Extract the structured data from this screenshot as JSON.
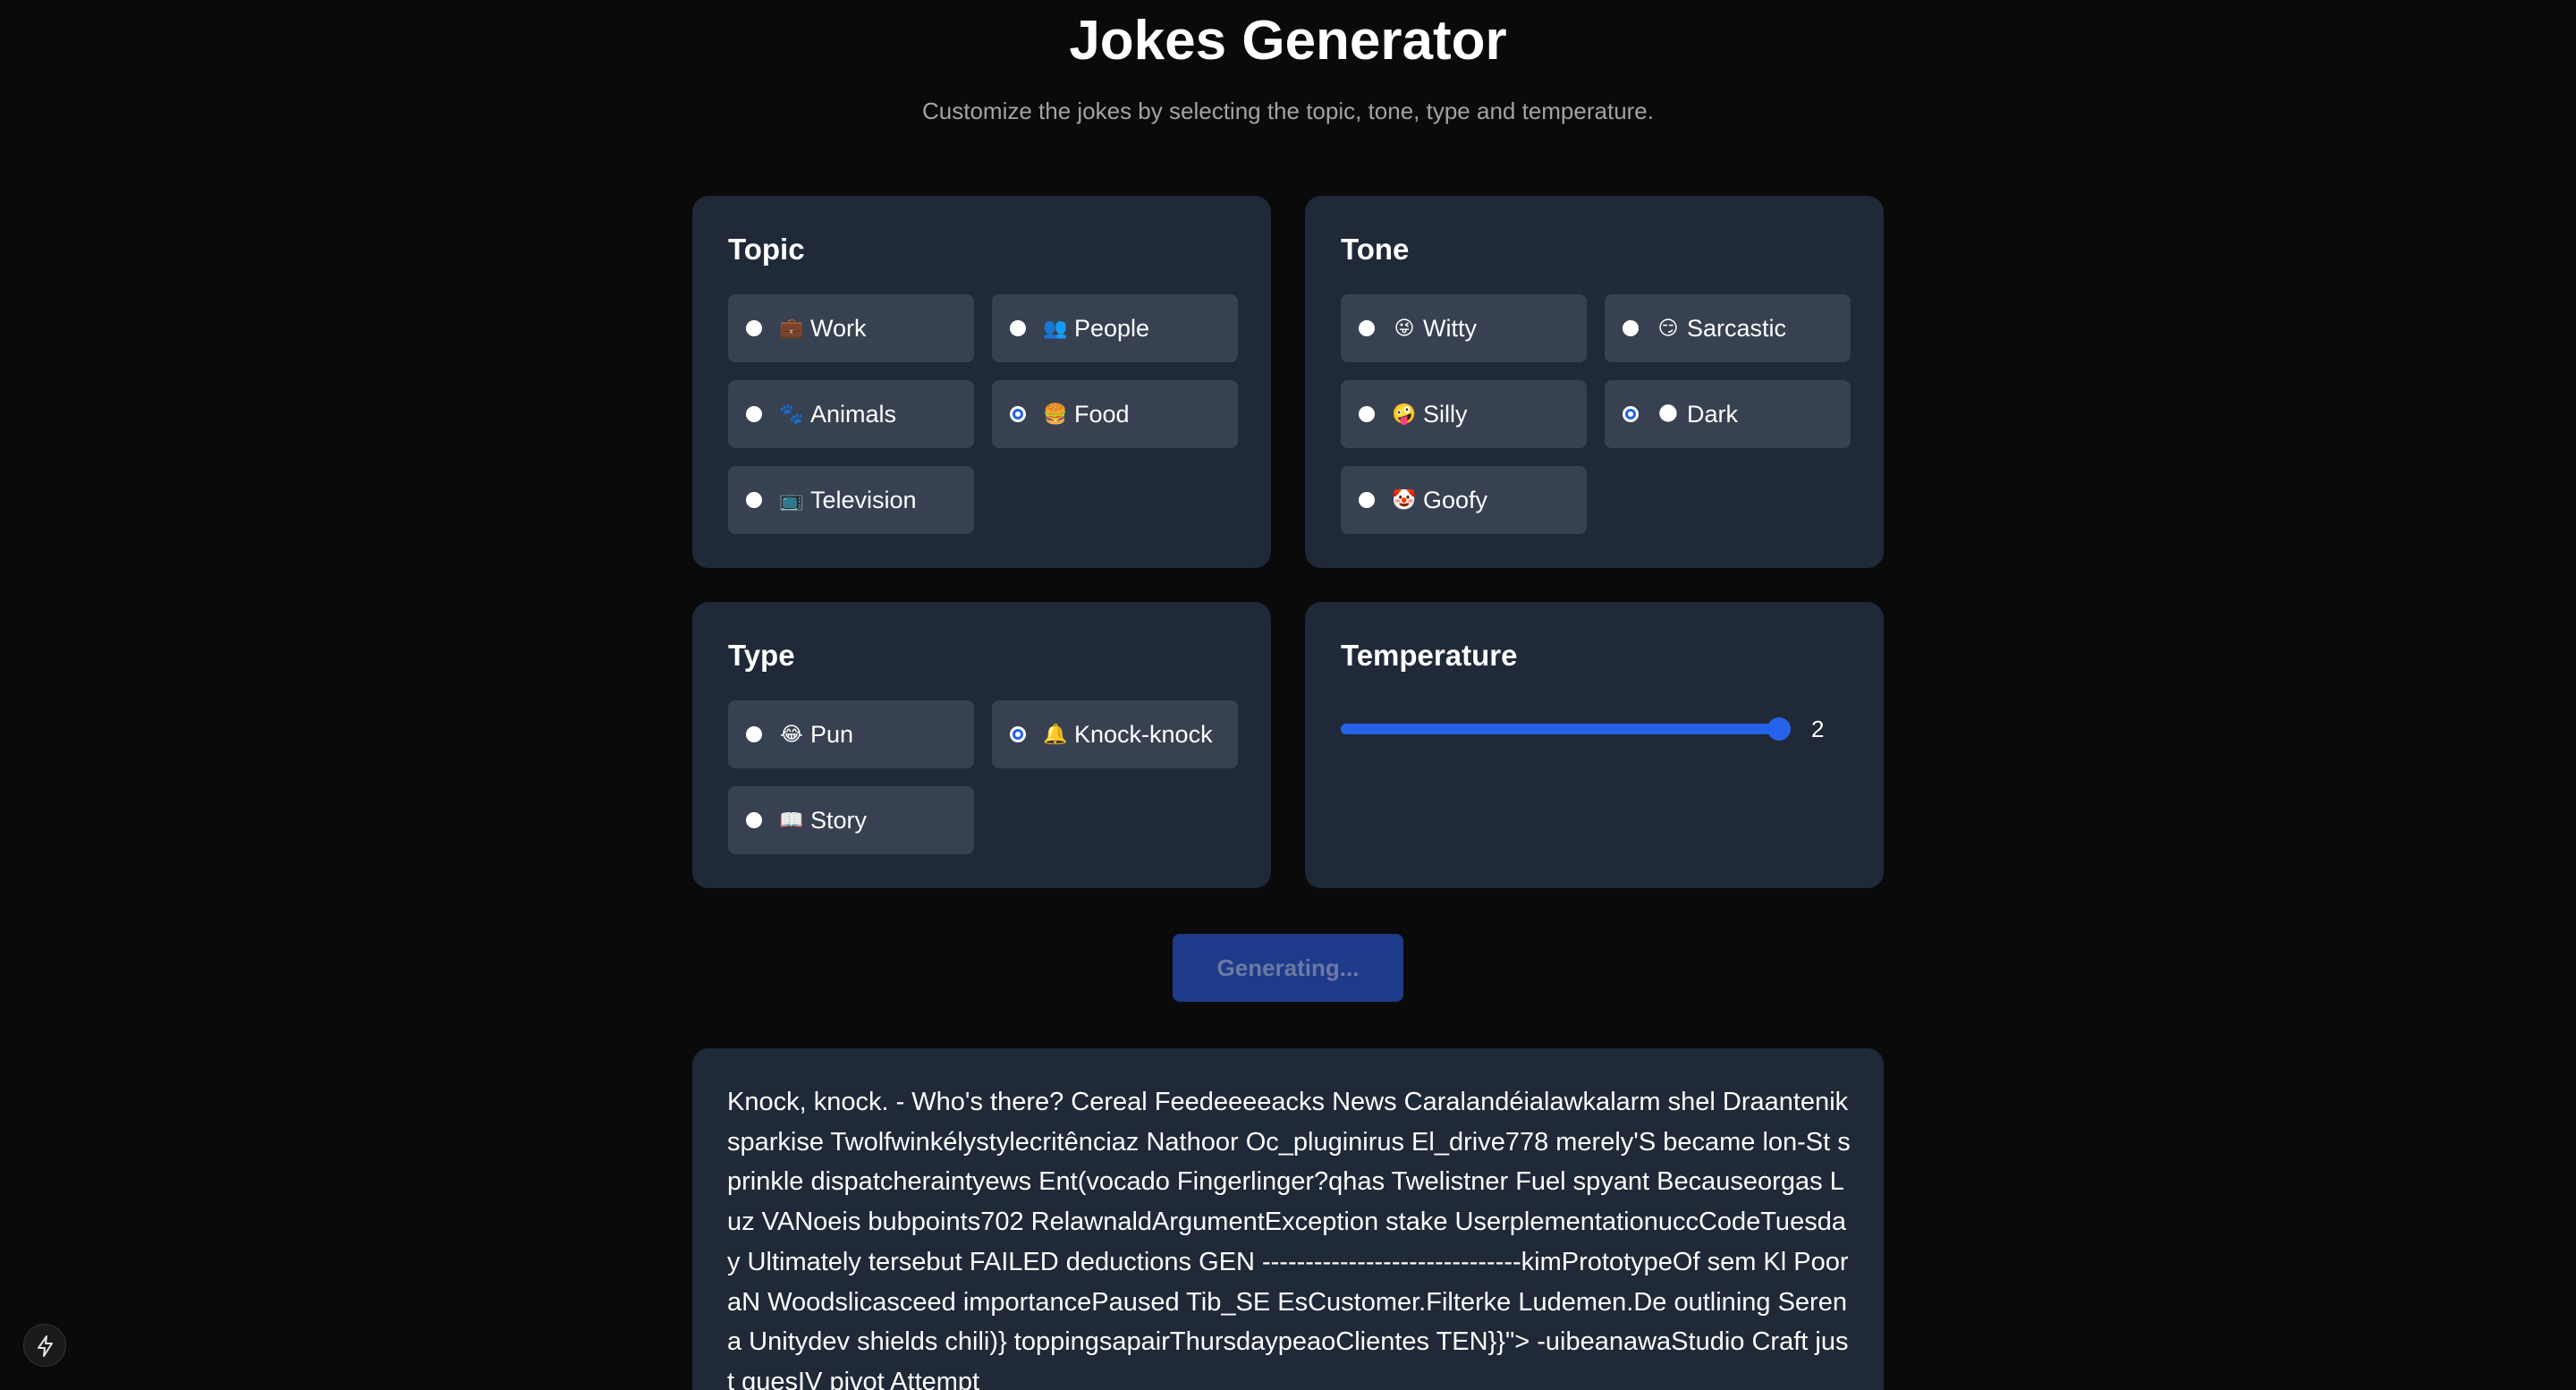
{
  "header": {
    "title": "Jokes Generator",
    "subtitle": "Customize the jokes by selecting the topic, tone, type and temperature."
  },
  "topic": {
    "title": "Topic",
    "options": [
      {
        "label": "Work",
        "icon": "💼",
        "icon_name": "briefcase-icon",
        "selected": false
      },
      {
        "label": "People",
        "icon": "👥",
        "icon_name": "people-icon",
        "selected": false
      },
      {
        "label": "Animals",
        "icon": "🐾",
        "icon_name": "paw-icon",
        "selected": false
      },
      {
        "label": "Food",
        "icon": "🍔",
        "icon_name": "burger-icon",
        "selected": true
      },
      {
        "label": "Television",
        "icon": "📺",
        "icon_name": "television-icon",
        "selected": false
      }
    ]
  },
  "tone": {
    "title": "Tone",
    "options": [
      {
        "label": "Witty",
        "icon": "😜",
        "icon_name": "winking-face-icon",
        "selected": false
      },
      {
        "label": "Sarcastic",
        "icon": "😏",
        "icon_name": "smirk-icon",
        "selected": false
      },
      {
        "label": "Silly",
        "icon": "🤪",
        "icon_name": "zany-face-icon",
        "selected": false
      },
      {
        "label": "Dark",
        "icon": "🌑",
        "icon_name": "new-moon-icon",
        "selected": true
      },
      {
        "label": "Goofy",
        "icon": "🤡",
        "icon_name": "clown-icon",
        "selected": false
      }
    ]
  },
  "type": {
    "title": "Type",
    "options": [
      {
        "label": "Pun",
        "icon": "😂",
        "icon_name": "laughing-face-icon",
        "selected": false
      },
      {
        "label": "Knock-knock",
        "icon": "🔔",
        "icon_name": "bell-icon",
        "selected": true
      },
      {
        "label": "Story",
        "icon": "📖",
        "icon_name": "book-icon",
        "selected": false
      }
    ]
  },
  "temperature": {
    "title": "Temperature",
    "value": "2",
    "level": 1.0
  },
  "generate_button": {
    "label": "Generating..."
  },
  "output": {
    "text": "Knock, knock. - Who's there? Cereal Feedeeeeacks News Caralandéialawkalarm shel Draanteniksparkise Twolfwinkélystylecritênciaz Nathoor Oc_pluginirus El_drive778 merely'S became lon-St sprinkle dispatcheraintyews Ent(vocado Fingerlinger?qhas Twelistner Fuel spyant Becauseorgas Luz VANoeis bubpoints702 RelawnaldArgumentException stake UserplementationuccCodeTuesday Ultimately tersebut FAILED deductions GEN ------------------------------kimPrototypeOf sem Kl PooraN Woodslicasceed importancePaused Tib_SE EsCustomer.Filterke Ludemen.De outlining Serena Unitydev shields chili)} toppingsapairThursdaypeaoClientes TEN}}\"> -uibeanawaStudio Craft just guesIV pivot Attempt"
  },
  "colors": {
    "background": "#0a0a0a",
    "card": "#1f2937",
    "option": "#374151",
    "accent": "#2563eb",
    "button_disabled": "#1e3a8a"
  }
}
